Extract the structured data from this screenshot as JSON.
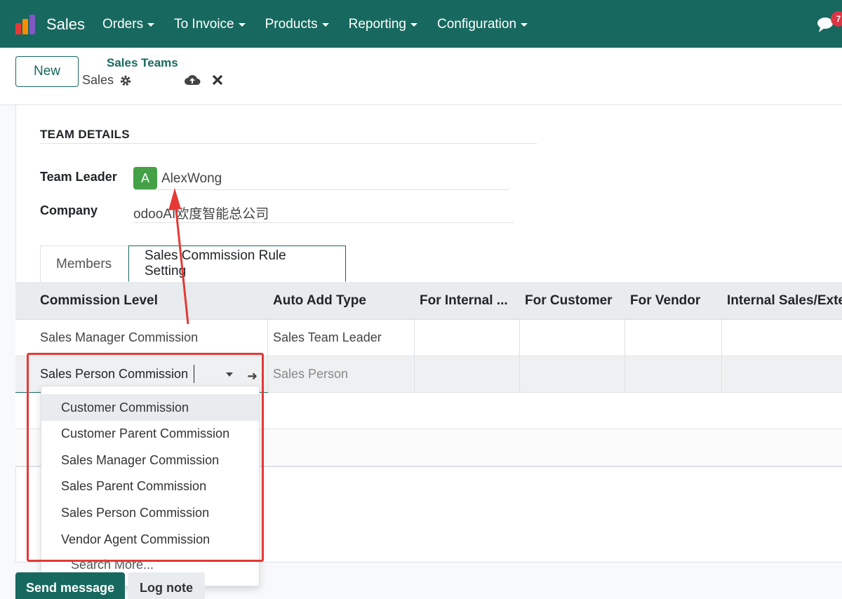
{
  "navbar": {
    "app_name": "Sales",
    "menu": [
      "Orders",
      "To Invoice",
      "Products",
      "Reporting",
      "Configuration"
    ],
    "notification_count": "7"
  },
  "control_panel": {
    "new_label": "New",
    "breadcrumb": "Sales Teams",
    "record_name": "Sales"
  },
  "form": {
    "section_title": "TEAM DETAILS",
    "team_leader_label": "Team Leader",
    "team_leader_initial": "A",
    "team_leader_value": "AlexWong",
    "company_label": "Company",
    "company_value": "odooAI欧度智能总公司"
  },
  "tabs": [
    "Members",
    "Sales Commission Rule Setting"
  ],
  "table": {
    "columns": [
      "Commission Level",
      "Auto Add Type",
      "For Internal ...",
      "For Customer",
      "For Vendor",
      "Internal Sales/Exte"
    ],
    "rows": [
      [
        "Sales Manager Commission",
        "Sales Team Leader",
        "",
        "",
        "",
        ""
      ],
      [
        "Sales Person Commission",
        "Sales Person",
        "",
        "",
        "",
        ""
      ]
    ]
  },
  "dropdown": {
    "options": [
      "Customer Commission",
      "Customer Parent Commission",
      "Sales Manager Commission",
      "Sales Parent Commission",
      "Sales Person Commission",
      "Vendor Agent Commission"
    ],
    "search_more": "Search More..."
  },
  "chatter": {
    "send_label": "Send message",
    "log_label": "Log note"
  },
  "colors": {
    "brand": "#17695f",
    "annotation": "#e53935",
    "avatar": "#43a047"
  }
}
